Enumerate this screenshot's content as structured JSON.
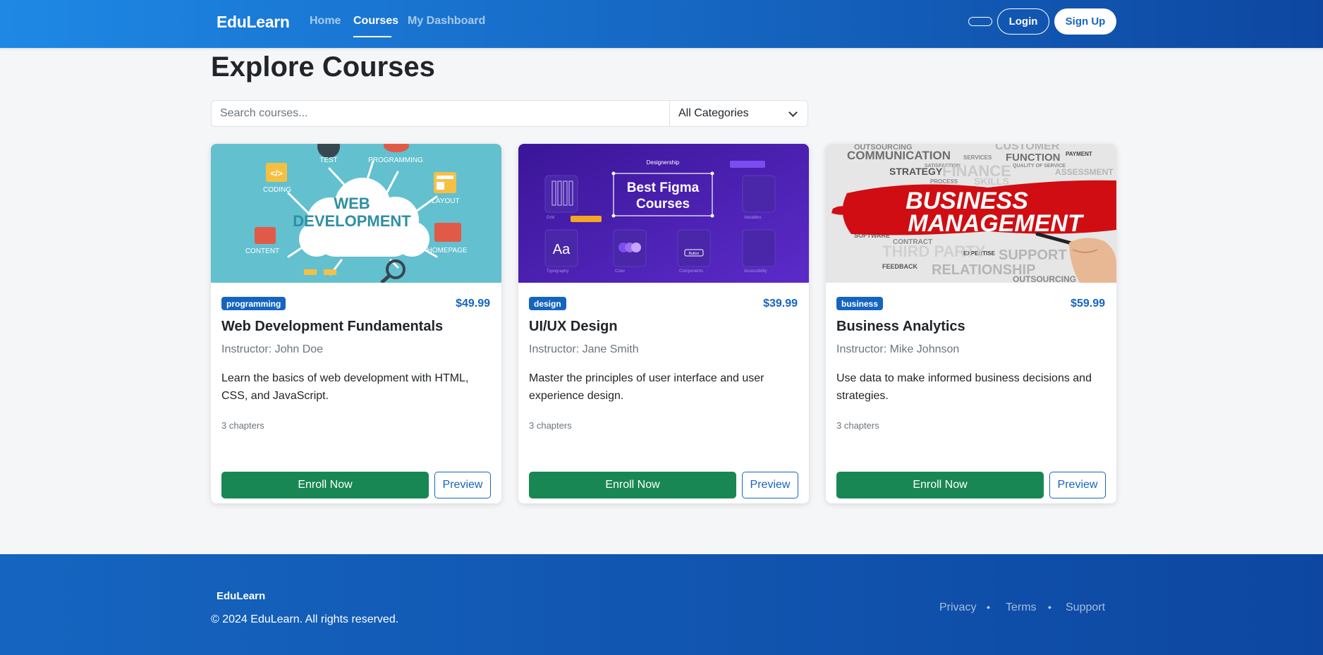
{
  "navbar": {
    "brand": "EduLearn",
    "links": [
      {
        "label": "Home",
        "active": false
      },
      {
        "label": "Courses",
        "active": true
      },
      {
        "label": "My Dashboard",
        "active": false
      }
    ],
    "login_label": "Login",
    "signup_label": "Sign Up"
  },
  "page": {
    "title": "Explore Courses",
    "search_placeholder": "Search courses...",
    "search_value": "",
    "category_selected": "All Categories"
  },
  "courses": [
    {
      "category": "programming",
      "price": "$49.99",
      "title": "Web Development Fundamentals",
      "instructor": "Instructor: John Doe",
      "description": "Learn the basics of web development with HTML, CSS, and JavaScript.",
      "chapters": "3 chapters",
      "enroll_label": "Enroll Now",
      "preview_label": "Preview",
      "image": {
        "center_lines": [
          "WEB",
          "DEVELOPMENT"
        ],
        "labels": [
          "TEST",
          "PROGRAMMING",
          "CODING",
          "LAYOUT",
          "CONTENT",
          "HOMEPAGE"
        ]
      }
    },
    {
      "category": "design",
      "price": "$39.99",
      "title": "UI/UX Design",
      "instructor": "Instructor: Jane Smith",
      "description": "Master the principles of user interface and user experience design.",
      "chapters": "3 chapters",
      "enroll_label": "Enroll Now",
      "preview_label": "Preview",
      "image": {
        "brand": "Designership",
        "center_lines": [
          "Best Figma",
          "Courses"
        ],
        "tile_text": "Aa",
        "button_text": "Button",
        "tile_labels": [
          "Grid",
          "Typography",
          "Color",
          "Components",
          "Variables",
          "Accessibility"
        ]
      }
    },
    {
      "category": "business",
      "price": "$59.99",
      "title": "Business Analytics",
      "instructor": "Instructor: Mike Johnson",
      "description": "Use data to make informed business decisions and strategies.",
      "chapters": "3 chapters",
      "enroll_label": "Enroll Now",
      "preview_label": "Preview",
      "image": {
        "center_lines": [
          "BUSINESS",
          "MANAGEMENT"
        ],
        "words": [
          "OUTSOURCING",
          "CUSTOMER",
          "COMMUNICATION",
          "SERVICES",
          "FUNCTION",
          "PAYMENT",
          "SATISFACTION",
          "QUALITY OF SERVICE",
          "STRATEGY",
          "FINANCE",
          "PROCESS",
          "SKILLS",
          "ASSESSMENT",
          "SOFTWARE",
          "CONTRACT",
          "EXPERTISE",
          "SUPPORT",
          "THIRD PARTY",
          "RELATIONSHIP",
          "FEEDBACK",
          "OUTSOURCING"
        ]
      }
    }
  ],
  "footer": {
    "brand": "EduLearn",
    "copyright": "© 2024 EduLearn. All rights reserved.",
    "links": [
      "Privacy",
      "Terms",
      "Support"
    ],
    "separator": "•"
  },
  "colors": {
    "nav_start": "#1e88e5",
    "nav_end": "#0d47a1",
    "accent": "#1565c0",
    "enroll": "#198754",
    "card_1_bg": "#63c0cf",
    "card_2_bg": "#3a1597",
    "card_3_red": "#d00d12"
  }
}
